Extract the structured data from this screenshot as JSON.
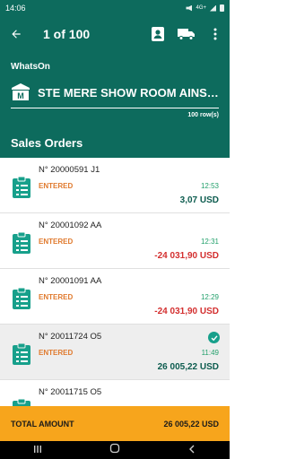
{
  "status_bar": {
    "time": "14:06",
    "network": "4G+"
  },
  "app_bar": {
    "title": "1 of 100"
  },
  "header": {
    "label": "WhatsOn",
    "store_name": "STE MERE SHOW ROOM AINSWORTH",
    "rows_count": "100 row(s)",
    "section_title": "Sales Orders"
  },
  "orders": [
    {
      "number": "N° 20000591 J1",
      "status": "ENTERED",
      "time": "12:53",
      "amount": "3,07 USD"
    },
    {
      "number": "N° 20001092 AA",
      "status": "ENTERED",
      "time": "12:31",
      "amount": "-24 031,90 USD"
    },
    {
      "number": "N° 20001091 AA",
      "status": "ENTERED",
      "time": "12:29",
      "amount": "-24 031,90 USD"
    },
    {
      "number": "N° 20011724 O5",
      "status": "ENTERED",
      "time": "11:49",
      "amount": "26 005,22 USD"
    },
    {
      "number": "N° 20011715 O5",
      "status": "",
      "time": "",
      "amount": ""
    }
  ],
  "total": {
    "label": "TOTAL AMOUNT",
    "amount": "26 005,22 USD"
  },
  "colors": {
    "primary": "#0d6b5d",
    "accent": "#f7a51c",
    "status_entered": "#e07a2e",
    "time": "#22a06b",
    "negative": "#d32f2f",
    "positive": "#0d5c4f"
  },
  "icons": [
    "back-arrow-icon",
    "contact-card-icon",
    "truck-icon",
    "more-vert-icon",
    "store-icon",
    "clipboard-icon",
    "check-circle-icon"
  ]
}
